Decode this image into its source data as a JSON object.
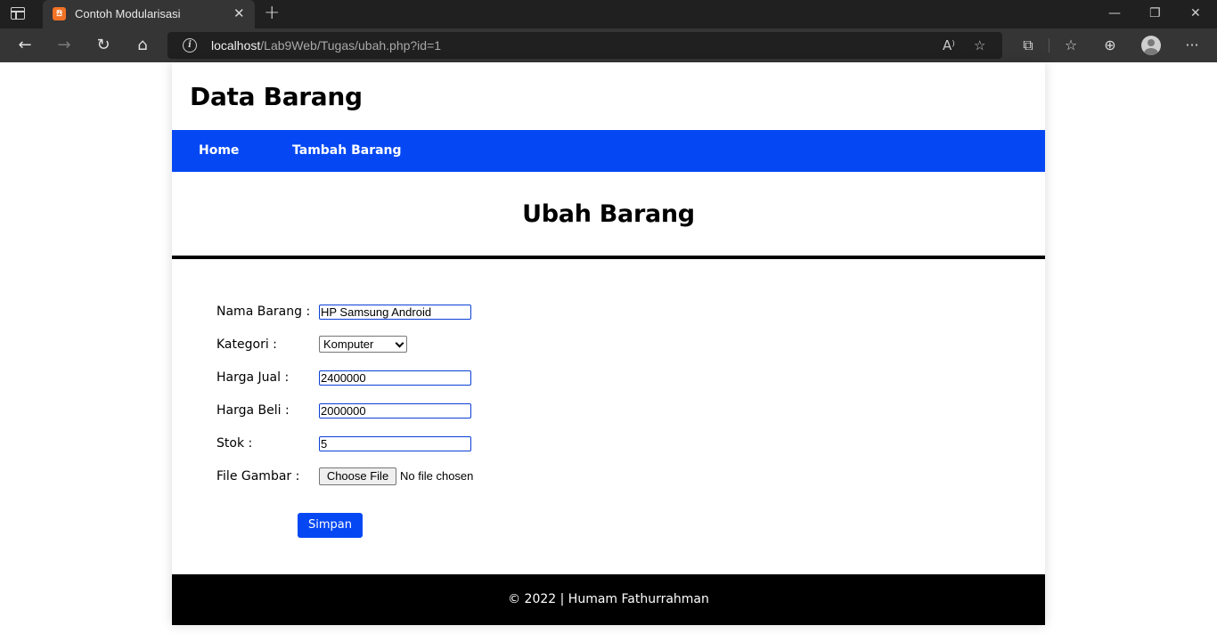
{
  "browser": {
    "tab_title": "Contoh Modularisasi",
    "tab_close": "✕",
    "new_tab": "+",
    "url_host": "localhost",
    "url_path": "/Lab9Web/Tugas/ubah.php?id=1",
    "window_minimize": "—",
    "window_restore": "❐",
    "window_close": "✕",
    "read_aloud": "A⁾",
    "more_menu": "···"
  },
  "header": {
    "title": "Data Barang"
  },
  "nav": {
    "items": [
      {
        "label": "Home"
      },
      {
        "label": "Tambah Barang"
      }
    ]
  },
  "main": {
    "title": "Ubah Barang",
    "form": {
      "nama_label": "Nama Barang :",
      "nama_value": "HP Samsung Android",
      "kategori_label": "Kategori :",
      "kategori_selected": "Komputer",
      "harga_jual_label": "Harga Jual :",
      "harga_jual_value": "2400000",
      "harga_beli_label": "Harga Beli :",
      "harga_beli_value": "2000000",
      "stok_label": "Stok :",
      "stok_value": "5",
      "gambar_label": "File Gambar :",
      "file_button": "Choose File",
      "file_status": "No file chosen",
      "submit": "Simpan"
    }
  },
  "footer": {
    "text": "© 2022 | Humam Fathurrahman"
  },
  "colors": {
    "navbar": "#0548f3",
    "footer": "#000000",
    "button": "#0548f3"
  }
}
